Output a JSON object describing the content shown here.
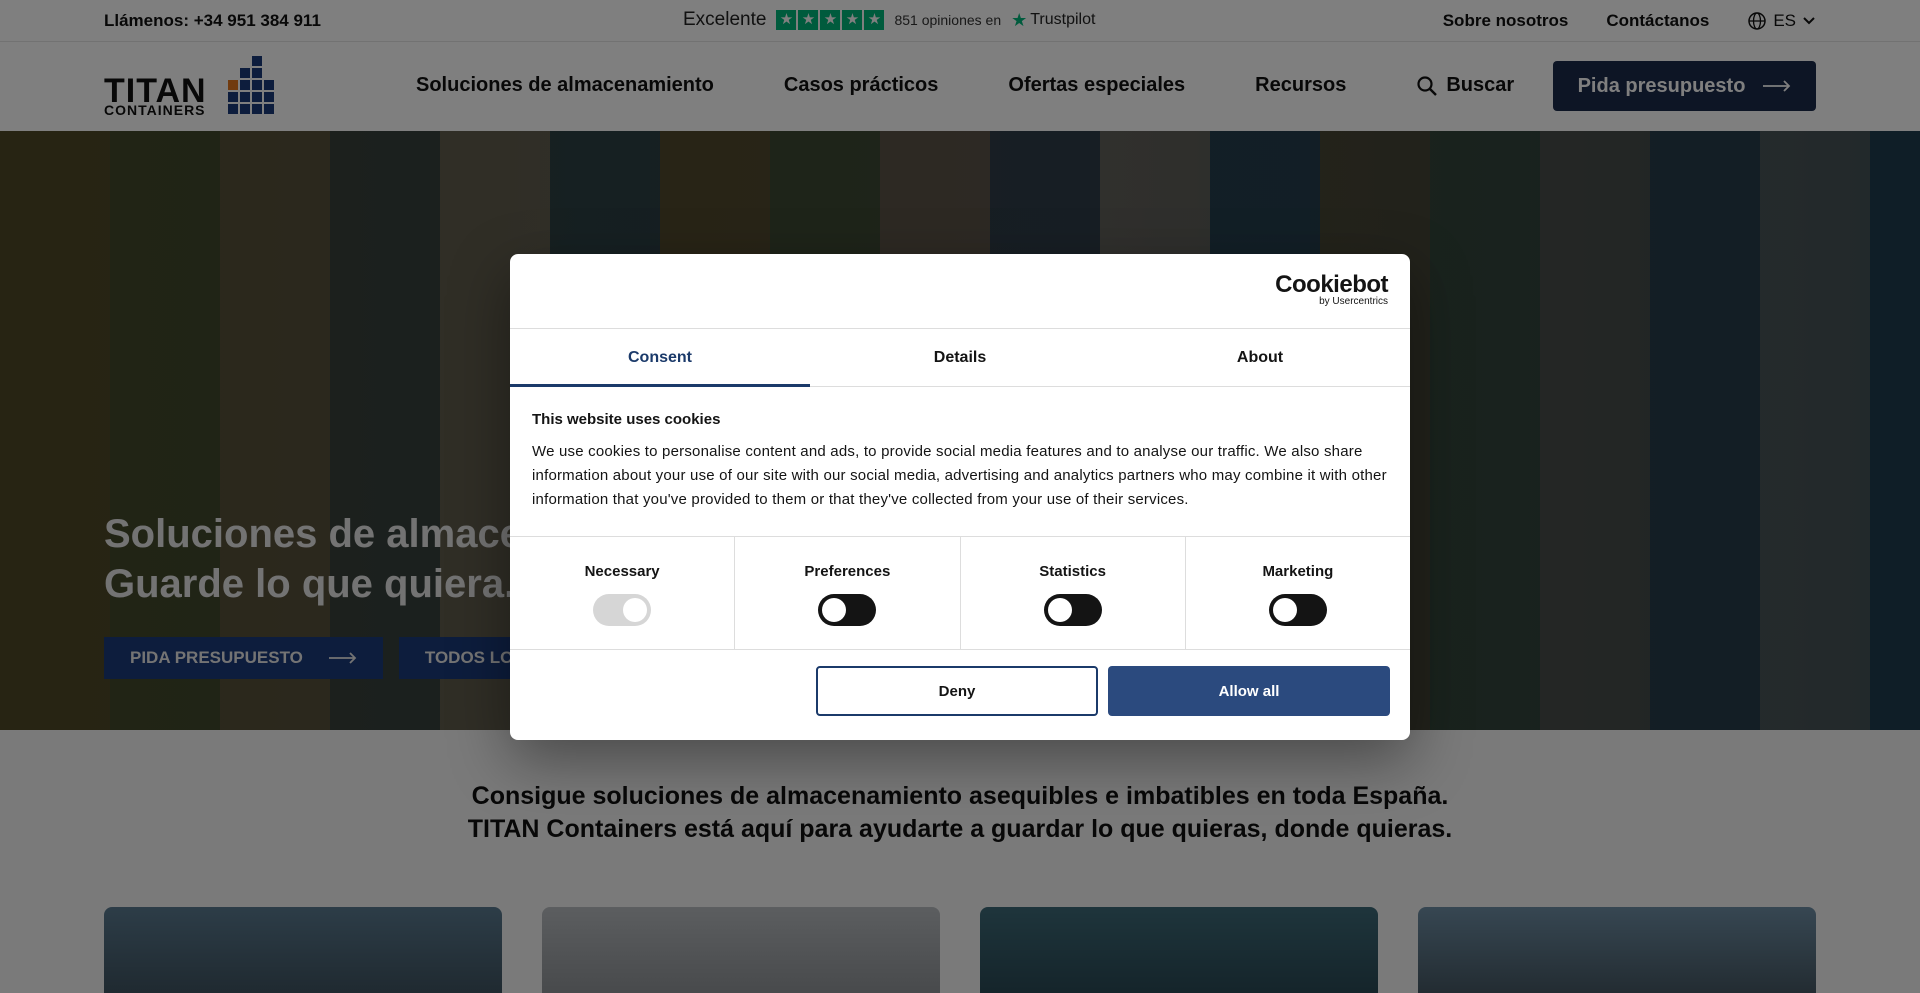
{
  "topbar": {
    "phone": "Llámenos: +34 951 384 911",
    "trust_rating": "Excelente",
    "trust_count": "851 opiniones en",
    "trust_brand": "Trustpilot",
    "links": [
      "Sobre nosotros",
      "Contáctanos"
    ],
    "lang": "ES"
  },
  "header": {
    "logo_main": "TITAN",
    "logo_sub": "CONTAINERS",
    "nav": [
      "Soluciones de almacenamiento",
      "Casos prácticos",
      "Ofertas especiales",
      "Recursos"
    ],
    "search_label": "Buscar",
    "cta_label": "Pida presupuesto"
  },
  "hero": {
    "title_line1": "Soluciones de almacen",
    "title_line2": "Guarde lo que quiera. D",
    "btn_quote": "PIDA PRESUPUESTO",
    "btn_all": "TODOS LOS"
  },
  "intro": {
    "line1": "Consigue soluciones de almacenamiento asequibles e imbatibles en toda España.",
    "line2": "TITAN Containers está aquí para ayudarte a guardar lo que quieras, donde quieras."
  },
  "cookie": {
    "brand": "Cookiebot",
    "brand_sub": "by Usercentrics",
    "tabs": [
      "Consent",
      "Details",
      "About"
    ],
    "title": "This website uses cookies",
    "text": "We use cookies to personalise content and ads, to provide social media features and to analyse our traffic. We also share information about your use of our site with our social media, advertising and analytics partners who may combine it with other information that you've provided to them or that they've collected from your use of their services.",
    "toggles": [
      "Necessary",
      "Preferences",
      "Statistics",
      "Marketing"
    ],
    "deny_label": "Deny",
    "allow_label": "Allow all"
  },
  "colors": {
    "brand_navy": "#1b2a4a",
    "trustpilot": "#00b67a",
    "allow": "#2b4a7e"
  }
}
